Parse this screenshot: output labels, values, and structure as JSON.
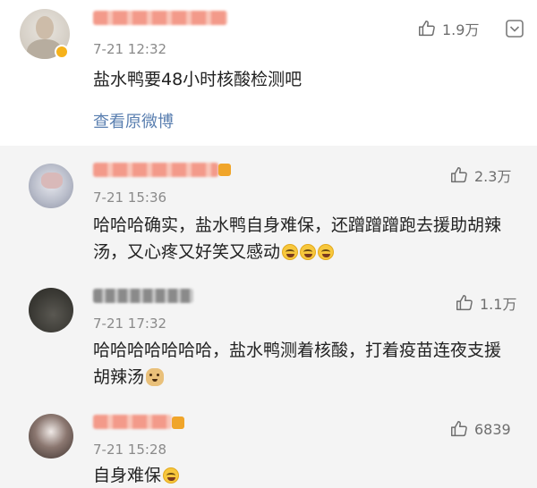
{
  "post": {
    "time": "7-21 12:32",
    "text": "盐水鸭要48小时核酸检测吧",
    "view_original": "查看原微博",
    "likes": "1.9万"
  },
  "replies": [
    {
      "time": "7-21 15:36",
      "text": "哈哈哈确实，盐水鸭自身难保，还蹭蹭蹭跑去援助胡辣汤，又心疼又好笑又感动",
      "likes": "2.3万",
      "emojis": [
        "laugh-cry",
        "laugh-cry",
        "laugh-cry"
      ]
    },
    {
      "time": "7-21 17:32",
      "text": "哈哈哈哈哈哈哈，盐水鸭测着核酸，打着疫苗连夜支援胡辣汤",
      "likes": "1.1万",
      "emojis": [
        "doge"
      ]
    },
    {
      "time": "7-21 15:28",
      "text": "自身难保",
      "likes": "6839",
      "emojis": [
        "laugh-cry"
      ]
    }
  ],
  "colors": {
    "link": "#5a7fb0",
    "reply_bg": "#f4f4f4",
    "meta": "#8a8a8a"
  },
  "icons": {
    "like": "thumbs-up-icon",
    "menu": "chevron-down-icon",
    "verified": "verified-badge-icon"
  }
}
